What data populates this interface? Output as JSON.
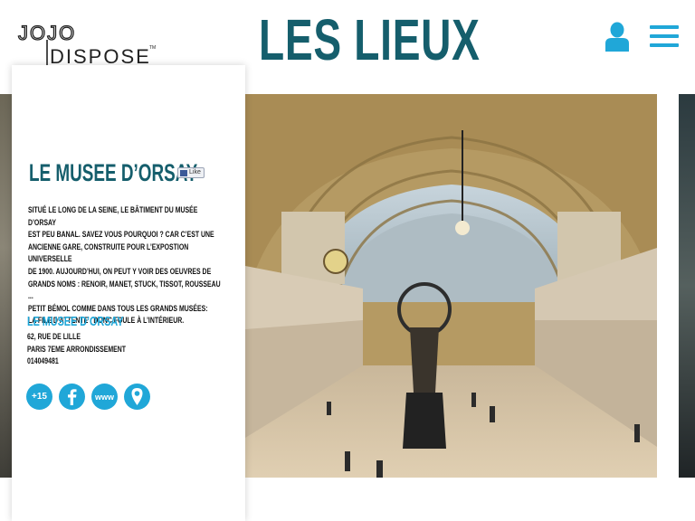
{
  "logo": {
    "line1": "JOJO",
    "line2": "DISPOSE",
    "tm": "TM"
  },
  "header": {
    "title": "LES LIEUX"
  },
  "icons": {
    "user": "user-icon",
    "menu": "hamburger-menu-icon"
  },
  "colors": {
    "teal": "#155e6c",
    "accent": "#20a7d8"
  },
  "place": {
    "title": "LE MUSEE D’ORSAY",
    "like_label": "Like",
    "description": [
      "SITUÉ LE LONG DE LA SEINE, LE BÂTIMENT DU MUSÉE D’ORSAY",
      "EST PEU BANAL. SAVEZ VOUS POURQUOI ? CAR C’EST UNE",
      "ANCIENNE GARE, CONSTRUITE POUR L’EXPOSTION UNIVERSELLE",
      "DE 1900. AUJOURD’HUI, ON PEUT Y VOIR DES OEUVRES DE",
      "GRANDS NOMS : RENOIR, MANET, STUCK, TISSOT, ROUSSEAU ...",
      "PETIT BÉMOL COMME DANS TOUS LES GRANDS MUSÉES:",
      "LA FILE D’ATTENTE ; DONC FOULE À L’INTÉRIEUR."
    ],
    "address_title": "LE MUSEE D’ORSAY",
    "address": [
      "62, RUE DE LILLE",
      "PARIS 7EME ARRONDISSEMENT",
      "014049481"
    ],
    "socials": {
      "plus": "+15",
      "facebook": "facebook-icon",
      "www": "www",
      "location": "map-pin-icon"
    }
  }
}
